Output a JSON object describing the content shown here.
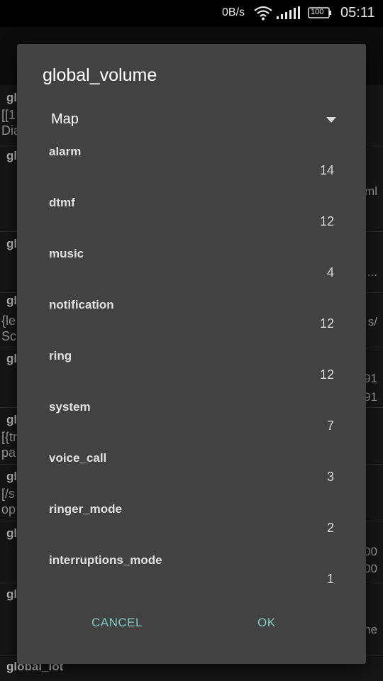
{
  "status_bar": {
    "net_speed": "0B/s",
    "battery": "100",
    "time": "05:11",
    "icons": [
      "wifi-icon",
      "signal-icon",
      "battery-icon"
    ]
  },
  "background": {
    "fragments_left": [
      "globa",
      "[[1",
      "Dia",
      "gl",
      "gl",
      "gl",
      "{le",
      "Sc",
      "gl",
      "gl",
      "[{tr",
      "pa",
      "gl",
      "[/s",
      "op",
      "gl",
      "gl"
    ],
    "fragments_right": [
      "ml",
      "...",
      "s/",
      "91",
      "91",
      "00",
      "00",
      "ne"
    ],
    "bottom_key": "global_iot"
  },
  "dialog": {
    "title": "global_volume",
    "spinner": {
      "selected": "Map"
    },
    "items": [
      {
        "key": "alarm",
        "value": "14"
      },
      {
        "key": "dtmf",
        "value": "12"
      },
      {
        "key": "music",
        "value": "4"
      },
      {
        "key": "notification",
        "value": "12"
      },
      {
        "key": "ring",
        "value": "12"
      },
      {
        "key": "system",
        "value": "7"
      },
      {
        "key": "voice_call",
        "value": "3"
      },
      {
        "key": "ringer_mode",
        "value": "2"
      },
      {
        "key": "interruptions_mode",
        "value": "1"
      }
    ],
    "cancel_label": "CANCEL",
    "ok_label": "OK"
  },
  "colors": {
    "dialog_bg": "#424242",
    "accent": "#80cbc4",
    "text_primary": "#ffffff"
  }
}
